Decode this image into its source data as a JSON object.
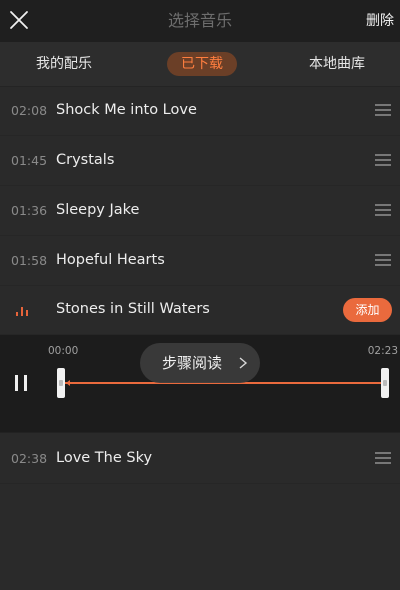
{
  "header": {
    "title": "选择音乐",
    "delete_label": "删除",
    "close_icon": "close-icon"
  },
  "tabs": [
    {
      "label": "我的配乐",
      "active": false
    },
    {
      "label": "已下载",
      "active": true
    },
    {
      "label": "本地曲库",
      "active": false
    }
  ],
  "tracks": [
    {
      "duration": "02:08",
      "title": "Shock Me into Love"
    },
    {
      "duration": "01:45",
      "title": "Crystals"
    },
    {
      "duration": "01:36",
      "title": "Sleepy Jake"
    },
    {
      "duration": "01:58",
      "title": "Hopeful Hearts"
    },
    {
      "title": "Stones in Still Waters",
      "playing": true,
      "add_label": "添加"
    },
    {
      "duration": "02:38",
      "title": "Love The Sky"
    }
  ],
  "player": {
    "time_start": "00:00",
    "time_end": "02:23",
    "tip_label": "步骤阅读"
  },
  "colors": {
    "accent": "#ea6a3d",
    "background": "#2a2a2a",
    "player_bg": "#1c1c1c"
  }
}
